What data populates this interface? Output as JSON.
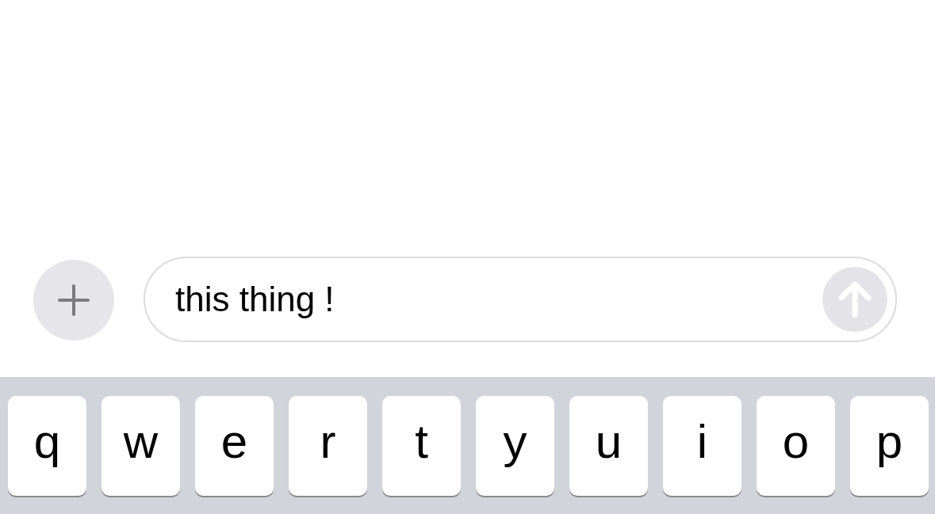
{
  "compose": {
    "value": "this thing !",
    "send_enabled": false
  },
  "keyboard": {
    "keys": [
      "q",
      "w",
      "e",
      "r",
      "t",
      "y",
      "u",
      "i",
      "o",
      "p"
    ]
  }
}
